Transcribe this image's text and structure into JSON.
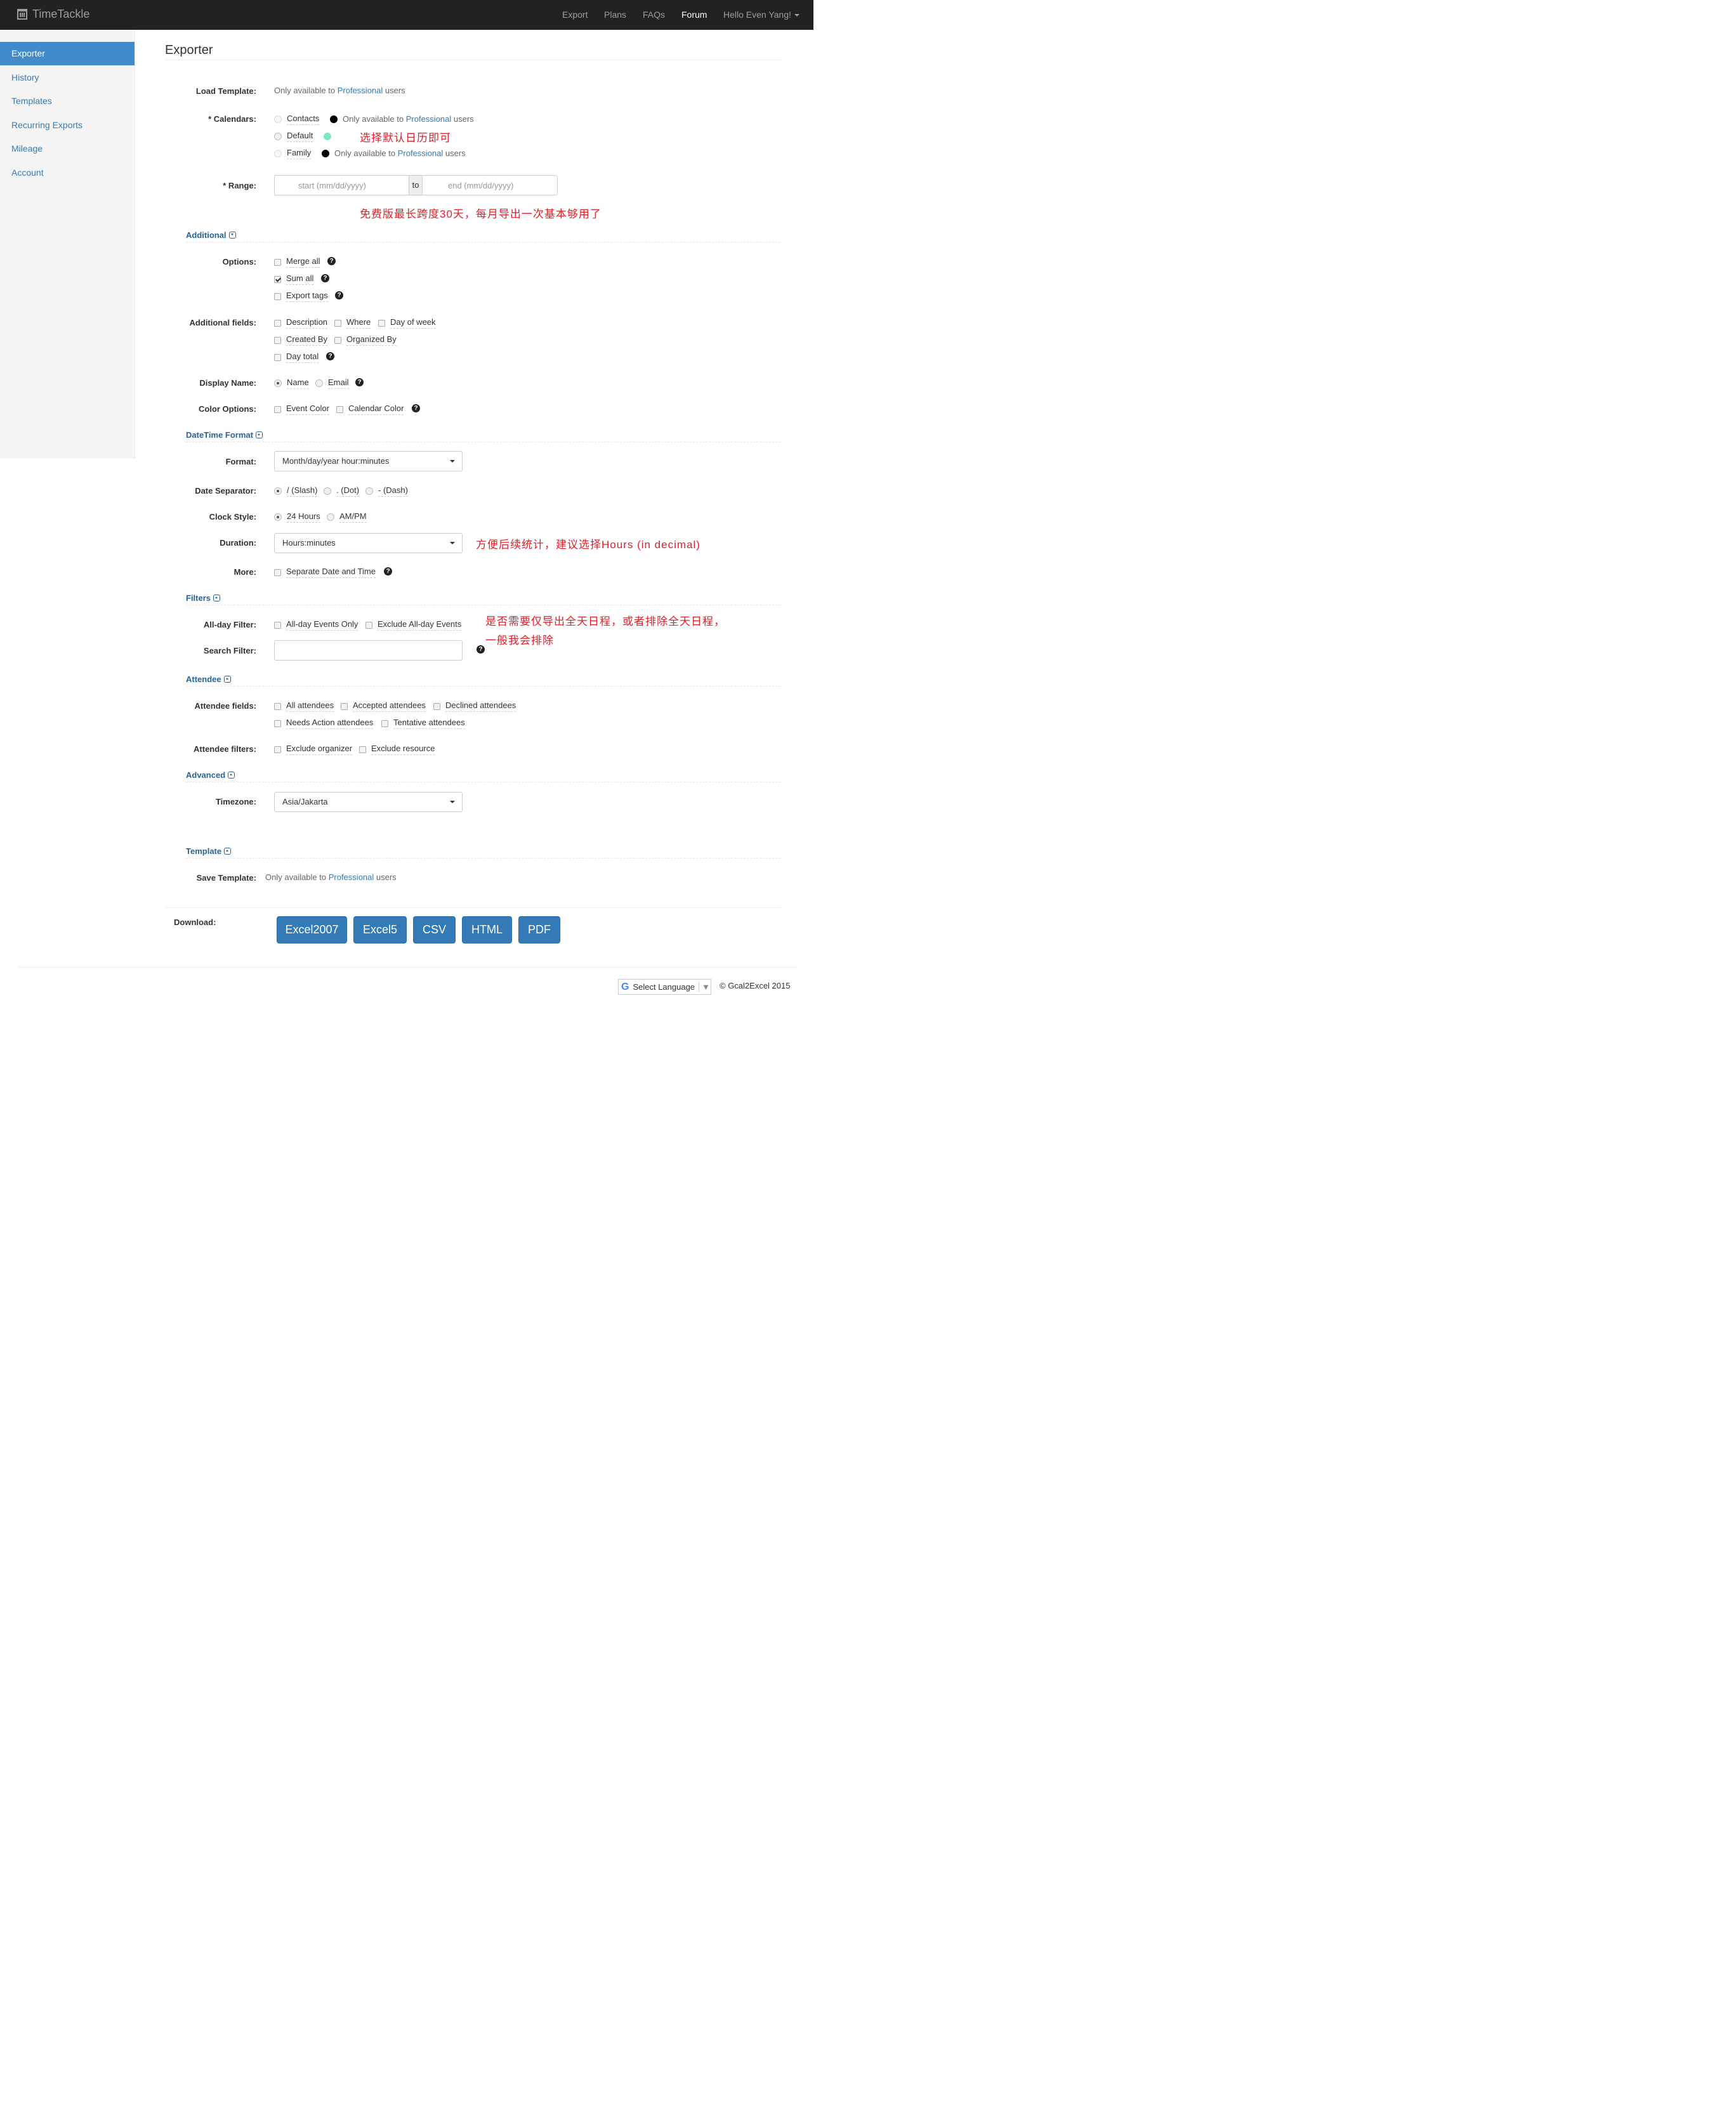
{
  "nav": {
    "brand": "TimeTackle",
    "links": [
      "Export",
      "Plans",
      "FAQs",
      "Forum"
    ],
    "user": "Hello Even Yang!"
  },
  "sidebar": {
    "items": [
      "Exporter",
      "History",
      "Templates",
      "Recurring Exports",
      "Mileage",
      "Account"
    ]
  },
  "page_title": "Exporter",
  "pro_notice": {
    "prefix": "Only available to ",
    "link": "Professional",
    "suffix": " users"
  },
  "labels": {
    "load_template": "Load Template:",
    "calendars": "* Calendars:",
    "range": "* Range:",
    "options": "Options:",
    "additional_fields": "Additional fields:",
    "display_name": "Display Name:",
    "color_options": "Color Options:",
    "format": "Format:",
    "date_separator": "Date Separator:",
    "clock_style": "Clock Style:",
    "duration": "Duration:",
    "more": "More:",
    "allday_filter": "All-day Filter:",
    "search_filter": "Search Filter:",
    "attendee_fields": "Attendee fields:",
    "attendee_filters": "Attendee filters:",
    "timezone": "Timezone:",
    "save_template": "Save Template:",
    "download": "Download:"
  },
  "calendars": [
    "Contacts",
    "Default",
    "Family"
  ],
  "calendar_colors": {
    "contacts": "#000000",
    "default": "#7ae7bf",
    "family": "#000000"
  },
  "range": {
    "start_placeholder": "start (mm/dd/yyyy)",
    "to": "to",
    "end_placeholder": "end (mm/dd/yyyy)"
  },
  "sections": {
    "additional": "Additional",
    "datetime": "DateTime Format",
    "filters": "Filters",
    "attendee": "Attendee",
    "advanced": "Advanced",
    "template": "Template"
  },
  "options": [
    {
      "label": "Merge all",
      "checked": false
    },
    {
      "label": "Sum all",
      "checked": true
    },
    {
      "label": "Export tags",
      "checked": false
    }
  ],
  "additional_fields": [
    "Description",
    "Where",
    "Day of week",
    "Created By",
    "Organized By",
    "Day total"
  ],
  "display_name": {
    "options": [
      "Name",
      "Email"
    ],
    "selected": "Name"
  },
  "color_options": [
    "Event Color",
    "Calendar Color"
  ],
  "format_value": "Month/day/year hour:minutes",
  "date_separator": {
    "options": [
      "/ (Slash)",
      ". (Dot)",
      "- (Dash)"
    ],
    "selected": "/ (Slash)"
  },
  "clock_style": {
    "options": [
      "24 Hours",
      "AM/PM"
    ],
    "selected": "24 Hours"
  },
  "duration_value": "Hours:minutes",
  "more": [
    "Separate Date and Time"
  ],
  "allday_filter": [
    "All-day Events Only",
    "Exclude All-day Events"
  ],
  "attendee_fields": [
    "All attendees",
    "Accepted attendees",
    "Declined attendees",
    "Needs Action attendees",
    "Tentative attendees"
  ],
  "attendee_filters": [
    "Exclude organizer",
    "Exclude resource"
  ],
  "timezone_value": "Asia/Jakarta",
  "download_buttons": [
    "Excel2007",
    "Excel5",
    "CSV",
    "HTML",
    "PDF"
  ],
  "footer": {
    "select_language": "Select Language",
    "copyright": "© Gcal2Excel 2015"
  },
  "annotations": {
    "calendar": "选择默认日历即可",
    "range": "免费版最长跨度30天，每月导出一次基本够用了",
    "duration": "方便后续统计，建议选择Hours (in decimal)",
    "filter_line1": "是否需要仅导出全天日程，或者排除全天日程，",
    "filter_line2": "一般我会排除"
  },
  "colors": {
    "accent": "#337ab7",
    "navbar": "#222222",
    "annotation": "#e0202a"
  }
}
